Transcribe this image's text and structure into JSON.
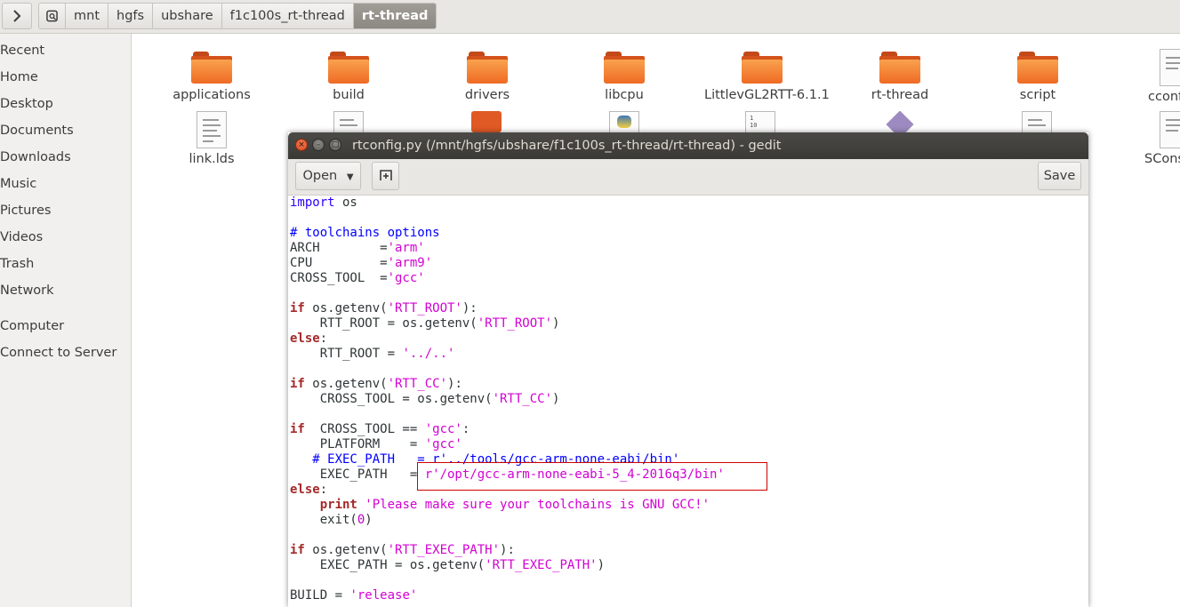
{
  "pathbar": {
    "crumbs": [
      "mnt",
      "hgfs",
      "ubshare",
      "f1c100s_rt-thread",
      "rt-thread"
    ],
    "active_crumb": "rt-thread"
  },
  "sidebar": {
    "items": [
      "Recent",
      "Home",
      "Desktop",
      "Documents",
      "Downloads",
      "Music",
      "Pictures",
      "Videos",
      "Trash",
      "Network",
      "Computer",
      "Connect to Server"
    ]
  },
  "files": {
    "row1": [
      "applications",
      "build",
      "drivers",
      "libcpu",
      "LittlevGL2RTT-6.1.1",
      "rt-thread",
      "script",
      "cconf"
    ],
    "row2": [
      "link.lds",
      "SCons"
    ]
  },
  "gedit": {
    "title": "rtconfig.py (/mnt/hgfs/ubshare/f1c100s_rt-thread/rt-thread) - gedit",
    "open_label": "Open",
    "save_label": "Save",
    "code": {
      "l1_kw": "import",
      "l1_rest": " os",
      "l3": "# toolchains options",
      "l4_a": "ARCH        =",
      "l4_s": "'arm'",
      "l5_a": "CPU         =",
      "l5_s": "'arm9'",
      "l6_a": "CROSS_TOOL  =",
      "l6_s": "'gcc'",
      "l8_kw": "if",
      "l8_a": " os.getenv(",
      "l8_s": "'RTT_ROOT'",
      "l8_b": "):",
      "l9_a": "    RTT_ROOT = os.getenv(",
      "l9_s": "'RTT_ROOT'",
      "l9_b": ")",
      "l10_kw": "else",
      "l10_b": ":",
      "l11_a": "    RTT_ROOT = ",
      "l11_s": "'../..'",
      "l13_kw": "if",
      "l13_a": " os.getenv(",
      "l13_s": "'RTT_CC'",
      "l13_b": "):",
      "l14_a": "    CROSS_TOOL = os.getenv(",
      "l14_s": "'RTT_CC'",
      "l14_b": ")",
      "l16_kw": "if",
      "l16_a": "  CROSS_TOOL == ",
      "l16_s": "'gcc'",
      "l16_b": ":",
      "l17_a": "    PLATFORM    = ",
      "l17_s": "'gcc'",
      "l18": "   # EXEC_PATH   = r'../tools/gcc-arm-none-eabi/bin'",
      "l19_a": "    EXEC_PATH   = ",
      "l19_s": "r'/opt/gcc-arm-none-eabi-5_4-2016q3/bin'",
      "l20_kw": "else",
      "l20_b": ":",
      "l21_kw": "    print",
      "l21_a": " ",
      "l21_s": "'Please make sure your toolchains is GNU GCC!'",
      "l22_a": "    exit(",
      "l22_n": "0",
      "l22_b": ")",
      "l24_kw": "if",
      "l24_a": " os.getenv(",
      "l24_s": "'RTT_EXEC_PATH'",
      "l24_b": "):",
      "l25_a": "    EXEC_PATH = os.getenv(",
      "l25_s": "'RTT_EXEC_PATH'",
      "l25_b": ")",
      "l27_a": "BUILD = ",
      "l27_s": "'release'"
    }
  },
  "colors": {
    "folder_orange": "#ef6a24",
    "titlebar_dark": "#3c3b37",
    "highlight_red": "#d00000"
  }
}
